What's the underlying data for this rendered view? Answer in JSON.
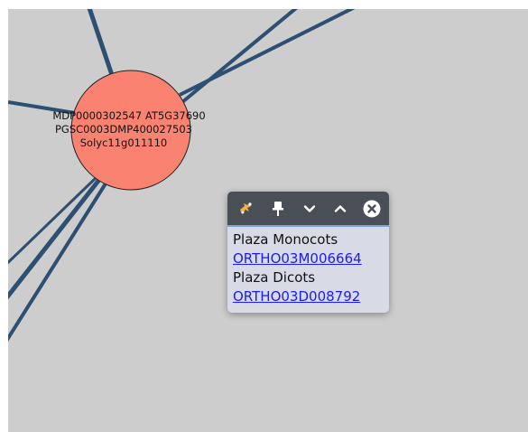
{
  "graph": {
    "node": {
      "label_lines": [
        "MDP0000302547 AT5G37690",
        "PGSC0003DMP400027503",
        "Solyc11g011110"
      ],
      "fill_color": "#f98271",
      "stroke_color": "#222222"
    },
    "edge_color": "#2c4f72",
    "background_color": "#cdcdcd"
  },
  "popup": {
    "toolbar": {
      "buttons": [
        {
          "name": "expand-icon",
          "color": "#f0b347"
        },
        {
          "name": "pin-icon",
          "color": "#ffffff"
        },
        {
          "name": "chevron-down-icon",
          "color": "#ffffff"
        },
        {
          "name": "chevron-up-icon",
          "color": "#ffffff"
        },
        {
          "name": "close-icon",
          "color": "#ffffff"
        }
      ]
    },
    "rows": [
      {
        "label": "Plaza Monocots",
        "link": "ORTHO03M006664"
      },
      {
        "label": "Plaza Dicots",
        "link": "ORTHO03D008792"
      }
    ]
  }
}
